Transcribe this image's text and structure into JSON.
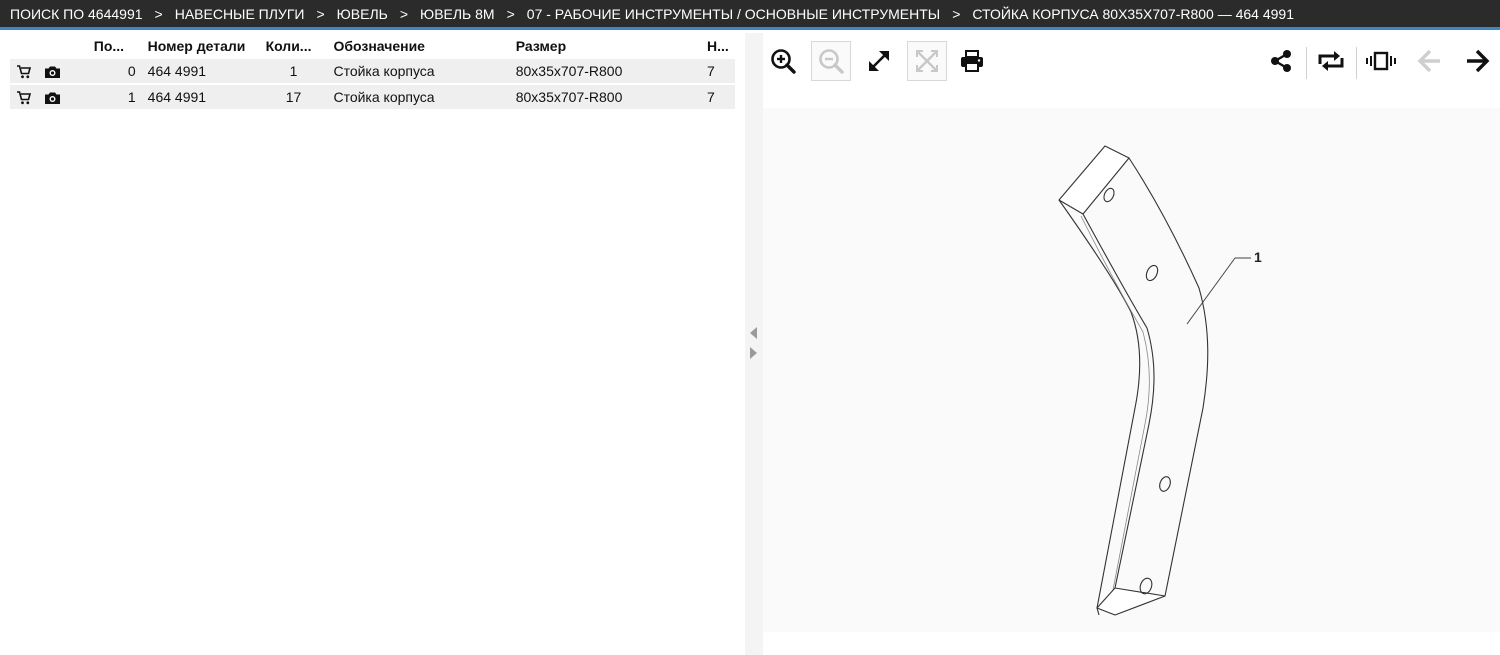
{
  "breadcrumb": [
    "ПОИСК ПО 4644991",
    "НАВЕСНЫЕ ПЛУГИ",
    "ЮВЕЛЬ",
    "ЮВЕЛЬ 8М",
    "07 - РАБОЧИЕ ИНСТРУМЕНТЫ / ОСНОВНЫЕ ИНСТРУМЕНТЫ",
    "СТОЙКА КОРПУСА 80X35X707-R800 — 464 4991"
  ],
  "breadcrumb_separator": ">",
  "table": {
    "columns": [
      "По...",
      "Номер детали",
      "Коли...",
      "Обозначение",
      "Размер",
      "Н..."
    ],
    "rows": [
      {
        "pos": "0",
        "part": "464 4991",
        "qty": "1",
        "name": "Стойка корпуса",
        "size": "80x35x707-R800",
        "n": "7"
      },
      {
        "pos": "1",
        "part": "464 4991",
        "qty": "17",
        "name": "Стойка корпуса",
        "size": "80x35x707-R800",
        "n": "7"
      }
    ]
  },
  "row_icons": [
    "cart-icon",
    "camera-icon"
  ],
  "toolbar_icons": [
    "zoom-in-icon",
    "zoom-out-icon",
    "expand-icon",
    "fit-icon",
    "print-icon",
    "share-icon",
    "repeat-icon",
    "carousel-icon",
    "arrow-left-icon",
    "arrow-right-icon"
  ],
  "drawing": {
    "callout": "1"
  },
  "colors": {
    "topbar_bg": "#2b2b2b",
    "topbar_accent": "#3a87c8",
    "row_bg": "#efefef"
  }
}
